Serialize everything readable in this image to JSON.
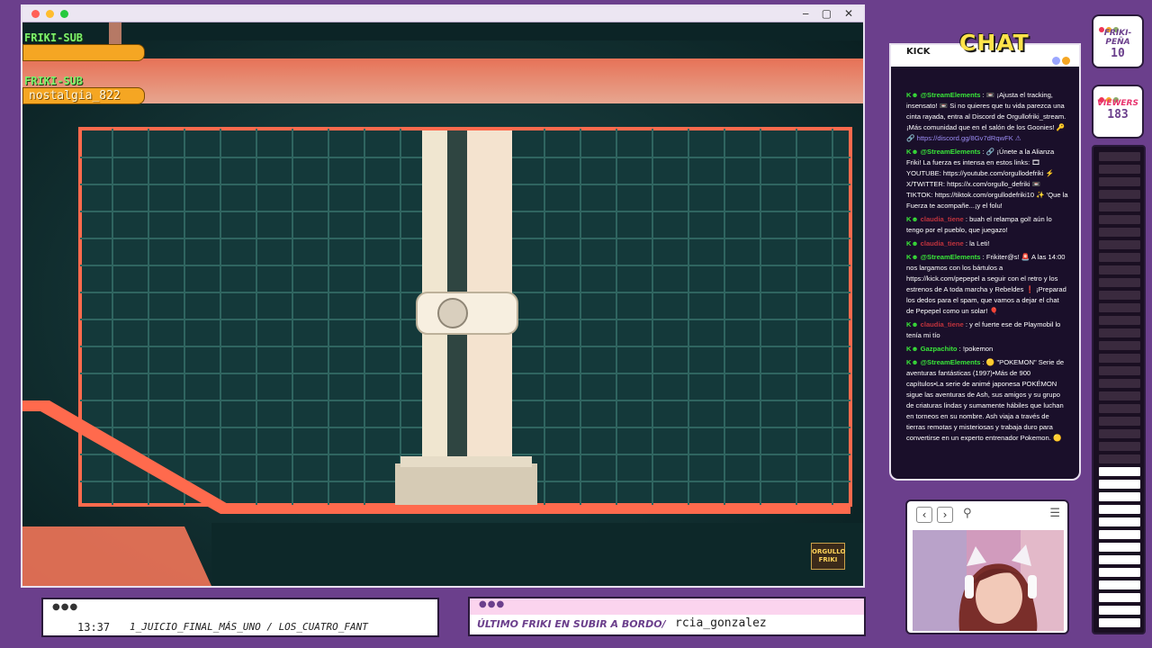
{
  "overlay": {
    "colors": {
      "background": "#6b3f8c",
      "accent": "#f5a623",
      "chat_title": "#ffe34a"
    }
  },
  "video_window": {
    "controls_label": "‒ ▢ ✕",
    "sub_alerts": [
      {
        "label": "FRIKI-SUB",
        "name": ""
      },
      {
        "label": "FRIKI-SUB",
        "name": "nostalgia_822"
      }
    ],
    "logo_text": "ORGULLO FRIKI"
  },
  "chat": {
    "platform": "KICK",
    "title": "CHAT",
    "messages": [
      {
        "badge": "K☻",
        "user": "@StreamElements",
        "user_color": "#39e639",
        "text": ": 📼 ¡Ajusta el tracking, insensato! 📼 Si no quieres que tu vida parezca una cinta rayada, entra al Discord de Orgullofriki_stream. ¡Más comunidad que en el salón de los Goonies! 🔑 🔗",
        "link": "https://discord.gg/8Gv7dRqwFK ⚠"
      },
      {
        "badge": "K☻",
        "user": "@StreamElements",
        "user_color": "#39e639",
        "text": ": 🔗 ¡Únete a la Alianza Friki! La fuerza es intensa en estos links: 🎞 YOUTUBE: https://youtube.com/orgullodefriki ⚡ X/TWITTER: https://x.com/orgullo_defriki 📼 TIKTOK: https://tiktok.com/orgullodefriki10 ✨ 'Que la Fuerza te acompañe...¡y el folu!",
        "link": ""
      },
      {
        "badge": "K☻",
        "user": "claudia_tiene",
        "user_color": "#c0333d",
        "text": ": buah el relampa gol! aún lo tengo por el pueblo, que juegazo!",
        "link": ""
      },
      {
        "badge": "K☻",
        "user": "claudia_tiene",
        "user_color": "#c0333d",
        "text": ": la Leti!",
        "link": ""
      },
      {
        "badge": "K☻",
        "user": "@StreamElements",
        "user_color": "#39e639",
        "text": ": Frikiter@s! 🚨 A las 14:00 nos largamos con los bártulos a https://kick.com/pepepel a seguir con el retro y los estrenos de A toda marcha y Rebeldes ❗ ¡Preparad los dedos para el spam, que vamos a dejar el chat de Pepepel como un solar! 🎈",
        "link": ""
      },
      {
        "badge": "K☻",
        "user": "claudia_tiene",
        "user_color": "#c0333d",
        "text": ": y el fuerte ese de Playmobil lo tenía mi tío",
        "link": ""
      },
      {
        "badge": "K☻",
        "user": "Gazpachito",
        "user_color": "#39e639",
        "text": ": !pokemon",
        "link": ""
      },
      {
        "badge": "K☻",
        "user": "@StreamElements",
        "user_color": "#39e639",
        "text": ": 🟡 \"POKEMON\" Serie de aventuras fantásticas (1997)•Más de 900 capítulos•La serie de animé japonesa POKÉMON sigue las aventuras de Ash, sus amigos y su grupo de criaturas lindas y sumamente hábiles que luchan en torneos en su nombre. Ash viaja a través de tierras remotas y misteriosas y trabaja duro para convertirse en un experto entrenador Pokemon. 🟡",
        "link": ""
      }
    ]
  },
  "widgets": {
    "friki_pena": {
      "title": "FRIKI-PEÑA",
      "value": "10"
    },
    "viewers": {
      "title": "VIEWERS",
      "value": "183"
    }
  },
  "audio_meter": {
    "level": 0.33
  },
  "now_playing": {
    "dots": "●●●",
    "time": "13:37",
    "track": "1_JUICIO_FINAL_MÁS_UNO / LOS_CUATRO_FANT"
  },
  "last_friki": {
    "dots": "●●●",
    "label": "ÚLTIMO FRIKI EN SUBIR A BORDO/",
    "name": "rcia_gonzalez"
  }
}
